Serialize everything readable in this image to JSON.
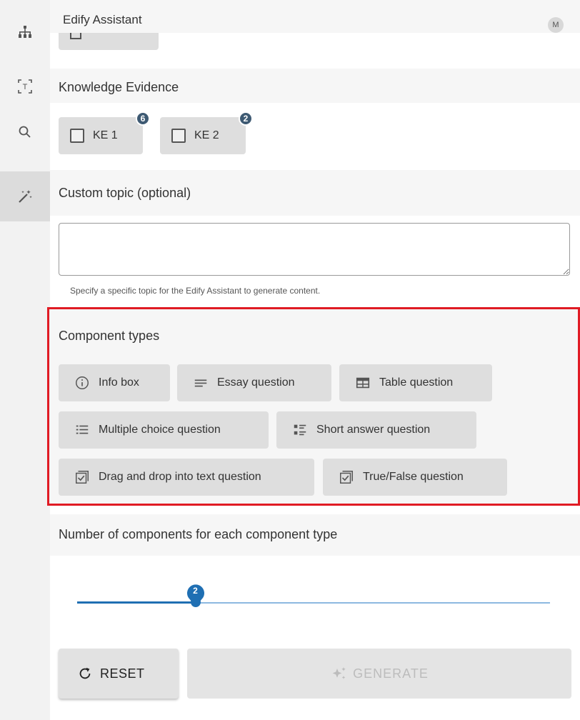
{
  "app": {
    "title": "Edify Assistant",
    "user_initial": "M"
  },
  "rail": {
    "items": [
      {
        "icon": "hierarchy-icon"
      },
      {
        "icon": "text-select-icon"
      },
      {
        "icon": "search-icon"
      },
      {
        "icon": "magic-wand-icon",
        "active": true
      }
    ]
  },
  "knowledge_evidence": {
    "label": "Knowledge Evidence",
    "chips": [
      {
        "label": "KE 1",
        "count": "6",
        "checked": false
      },
      {
        "label": "KE 2",
        "count": "2",
        "checked": false
      }
    ]
  },
  "custom_topic": {
    "label": "Custom topic (optional)",
    "value": "",
    "helper": "Specify a specific topic for the Edify Assistant to generate content."
  },
  "component_types": {
    "label": "Component types",
    "items": [
      {
        "label": "Info box",
        "icon": "info-circle-icon"
      },
      {
        "label": "Essay question",
        "icon": "lines-icon"
      },
      {
        "label": "Table question",
        "icon": "table-icon"
      },
      {
        "label": "Multiple choice question",
        "icon": "list-options-icon"
      },
      {
        "label": "Short answer question",
        "icon": "short-answer-icon"
      },
      {
        "label": "Drag and drop into text question",
        "icon": "checkbox-doc-icon"
      },
      {
        "label": "True/False question",
        "icon": "checkbox-doc-icon"
      }
    ]
  },
  "components_count": {
    "label": "Number of components for each component type",
    "value": "2",
    "fraction": 0.25
  },
  "actions": {
    "reset": "RESET",
    "generate": "GENERATE"
  },
  "colors": {
    "accent": "#1f6fb3",
    "badge": "#3e5a73",
    "highlight": "#e01b24",
    "chip": "#dedede"
  }
}
